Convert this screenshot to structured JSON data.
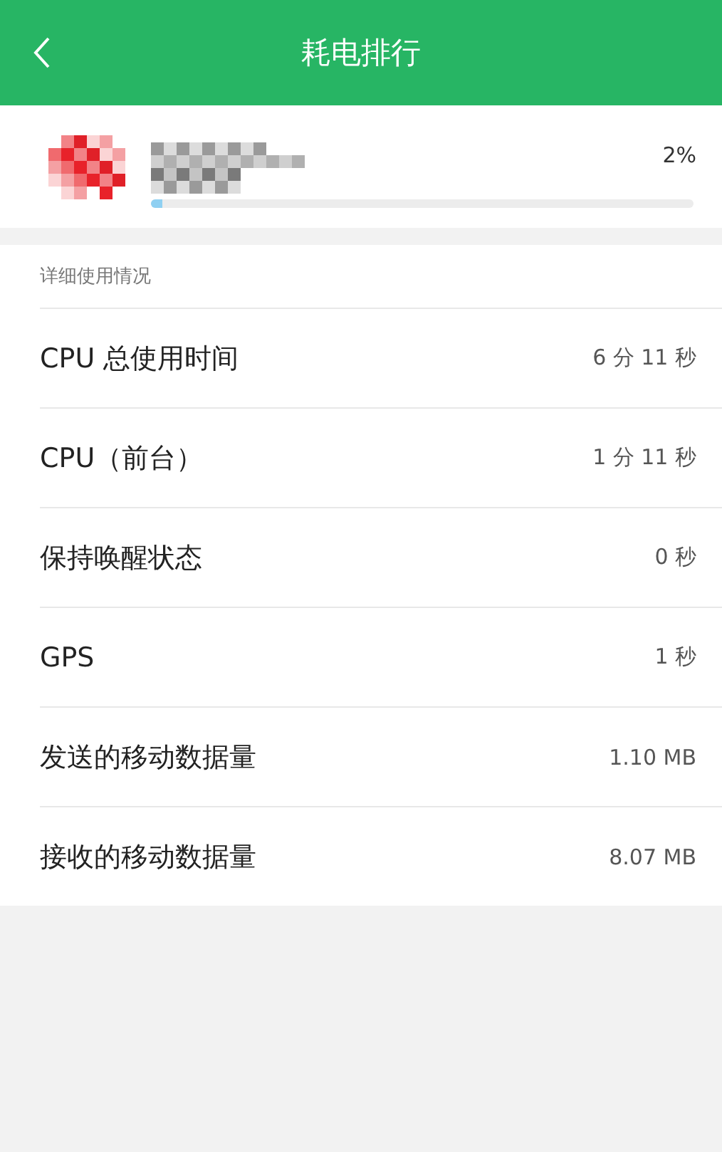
{
  "header": {
    "title": "耗电排行"
  },
  "app": {
    "percent": "2%",
    "level": 0.02
  },
  "section_title": "详细使用情况",
  "rows": [
    {
      "label": "CPU 总使用时间",
      "value": "6 分 11 秒"
    },
    {
      "label": "CPU（前台）",
      "value": "1 分 11 秒"
    },
    {
      "label": "保持唤醒状态",
      "value": "0 秒"
    },
    {
      "label": "GPS",
      "value": "1 秒"
    },
    {
      "label": "发送的移动数据量",
      "value": "1.10 MB"
    },
    {
      "label": "接收的移动数据量",
      "value": "8.07 MB"
    }
  ]
}
